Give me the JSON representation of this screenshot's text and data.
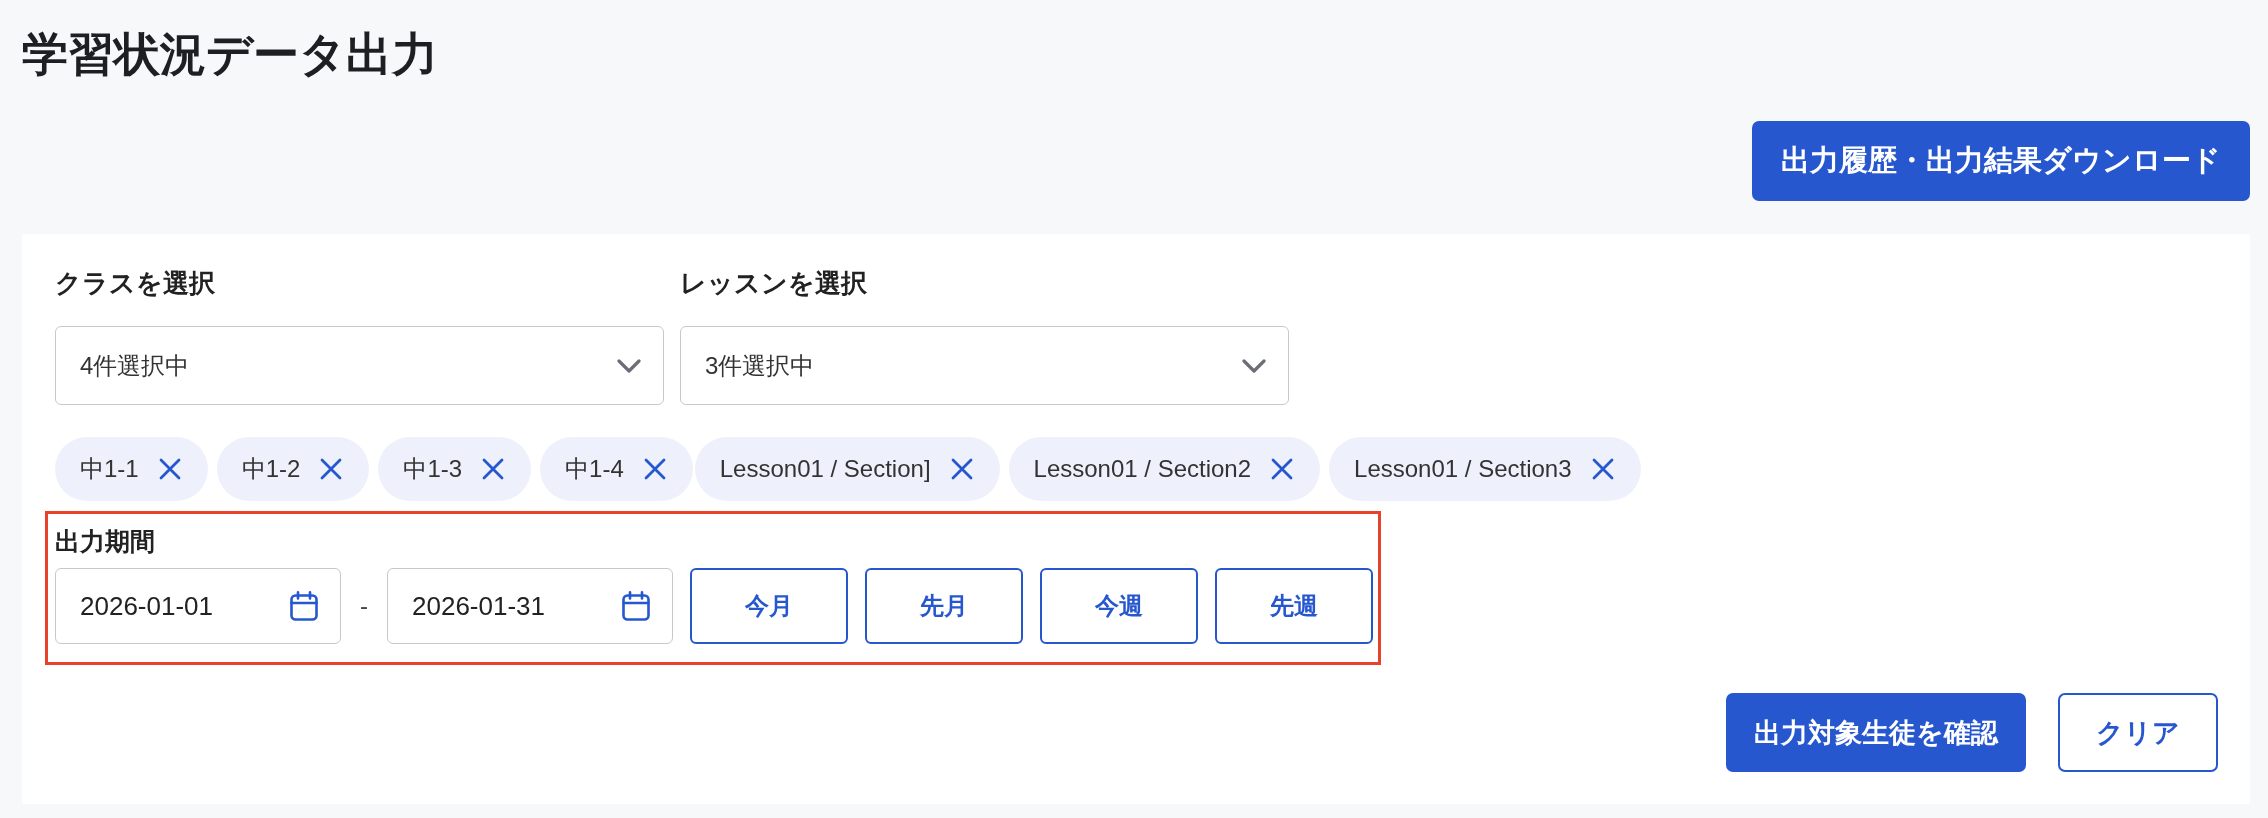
{
  "page": {
    "title": "学習状況データ出力"
  },
  "header_actions": [
    {
      "label": "出力履歴・出力結果ダウンロード",
      "kind": "primary"
    }
  ],
  "filters": {
    "selects": [
      {
        "label": "クラスを選択",
        "value": "4件選択中",
        "chips": [
          "中1-1",
          "中1-2",
          "中1-3",
          "中1-4"
        ]
      },
      {
        "label": "レッスンを選択",
        "value": "3件選択中",
        "chips": [
          "Lesson01 / Section]",
          "Lesson01 / Section2",
          "Lesson01 / Section3"
        ]
      }
    ]
  },
  "period": {
    "label": "出力期間",
    "highlighted": true,
    "start": "2026-01-01",
    "separator": "-",
    "end": "2026-01-31",
    "presets": [
      "今月",
      "先月",
      "今週",
      "先週"
    ]
  },
  "actions": [
    {
      "label": "出力対象生徒を確認",
      "kind": "primary"
    },
    {
      "label": "クリア",
      "kind": "secondary"
    }
  ]
}
